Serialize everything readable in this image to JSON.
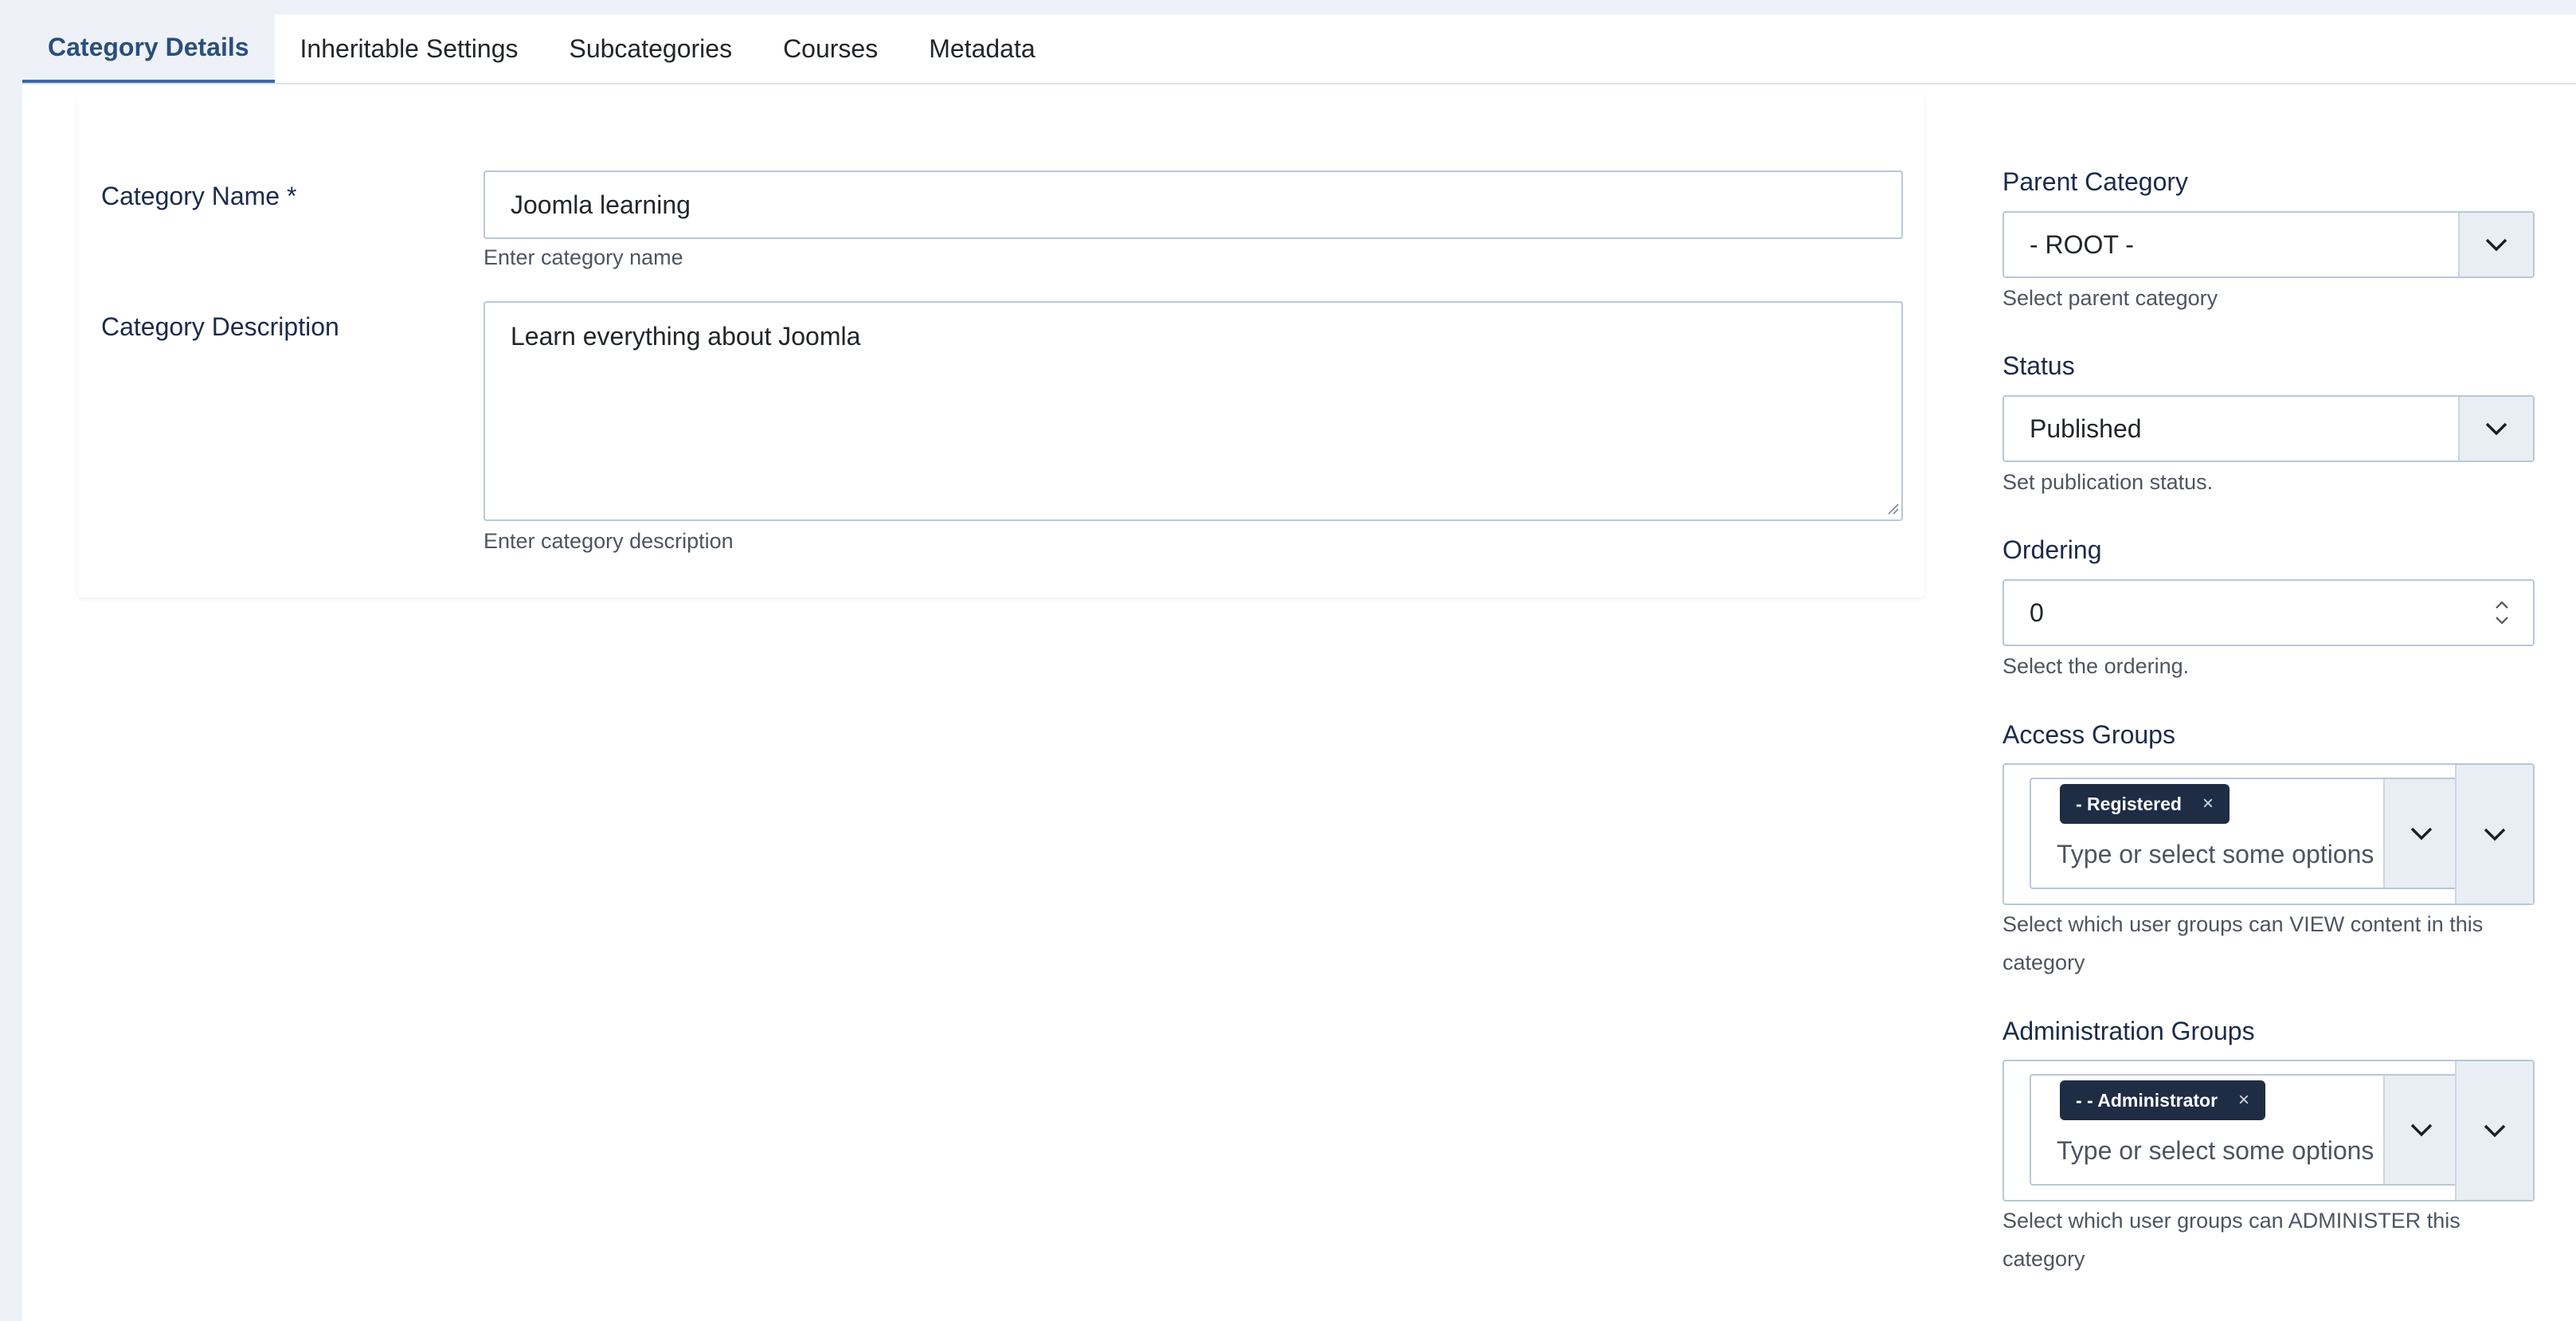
{
  "tabs": [
    {
      "label": "Category Details",
      "active": true
    },
    {
      "label": "Inheritable Settings",
      "active": false
    },
    {
      "label": "Subcategories",
      "active": false
    },
    {
      "label": "Courses",
      "active": false
    },
    {
      "label": "Metadata",
      "active": false
    }
  ],
  "main": {
    "name": {
      "label": "Category Name *",
      "value": "Joomla learning",
      "hint": "Enter category name"
    },
    "description": {
      "label": "Category Description",
      "value": "Learn everything about Joomla",
      "hint": "Enter category description"
    }
  },
  "side": {
    "parent": {
      "label": "Parent Category",
      "value": "- ROOT -",
      "hint": "Select parent category"
    },
    "status": {
      "label": "Status",
      "value": "Published",
      "hint": "Set publication status."
    },
    "ordering": {
      "label": "Ordering",
      "value": "0",
      "hint": "Select the ordering."
    },
    "access": {
      "label": "Access Groups",
      "chip": "- Registered",
      "chip_remove": "×",
      "placeholder": "Type or select some options",
      "hint": "Select which user groups can VIEW content in this category"
    },
    "admin": {
      "label": "Administration Groups",
      "chip": "- - Administrator",
      "chip_remove": "×",
      "placeholder": "Type or select some options",
      "hint": "Select which user groups can ADMINISTER this category"
    }
  },
  "colors": {
    "accent": "#3a68a8",
    "chip_bg": "#1f2d44",
    "border": "#b9c7d8"
  }
}
